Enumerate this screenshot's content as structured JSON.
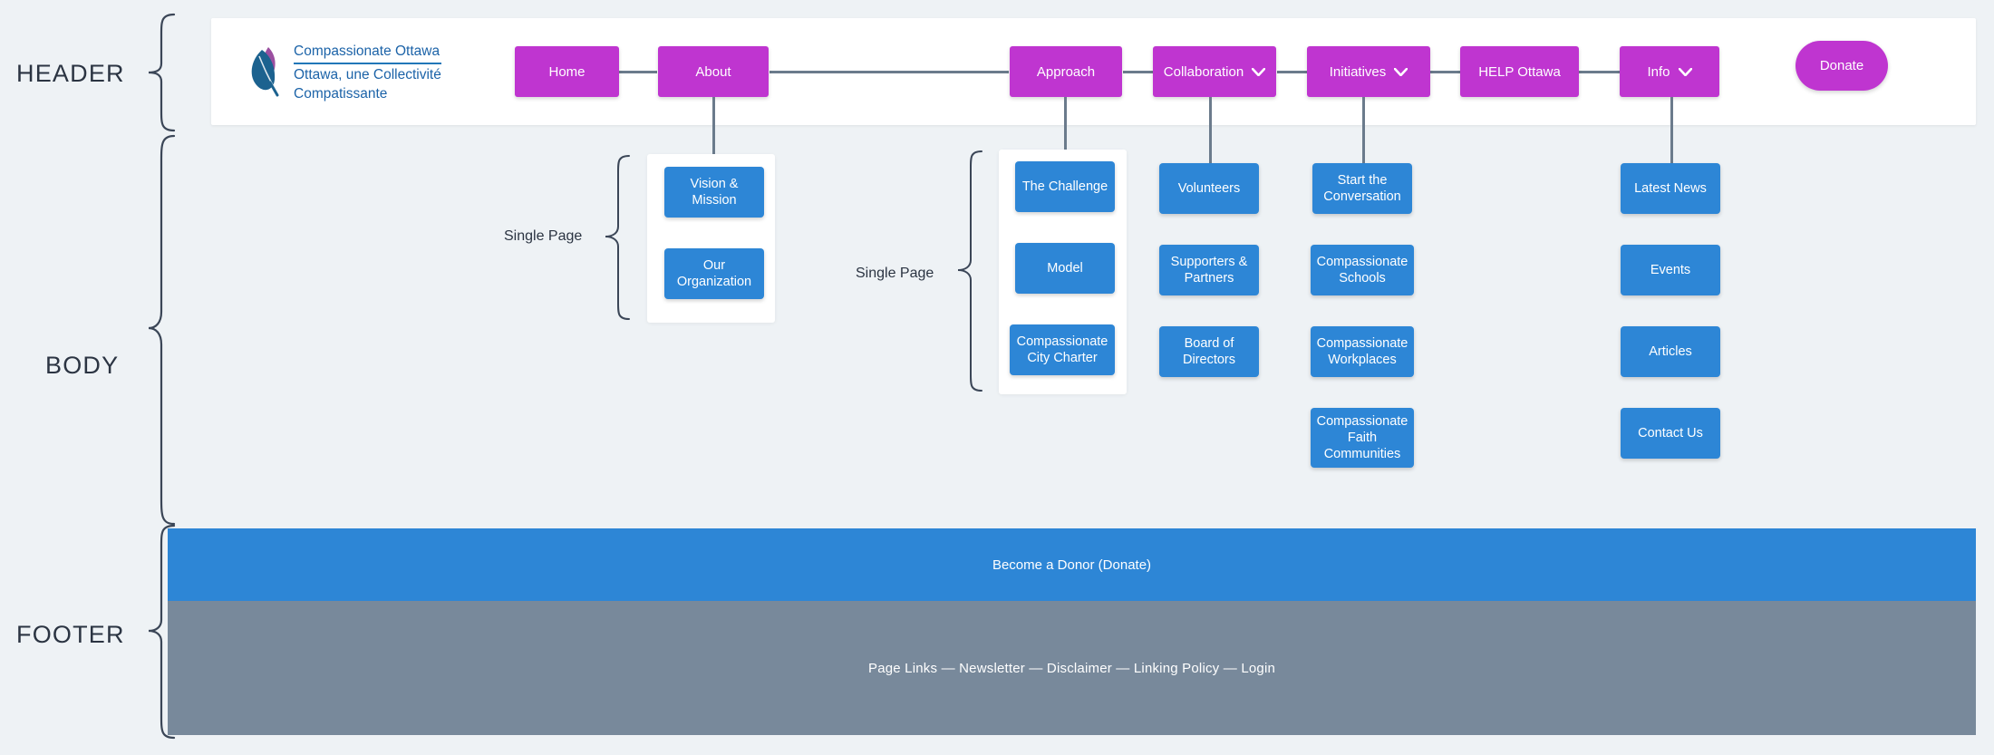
{
  "sections": {
    "header_label": "HEADER",
    "body_label": "BODY",
    "footer_label": "FOOTER"
  },
  "logo": {
    "icon": "leaf-logo-icon",
    "line1": "Compassionate Ottawa",
    "line2": "Ottawa, une Collectivité",
    "line3": "Compatissante"
  },
  "header": {
    "nav": [
      {
        "label": "Home",
        "has_dropdown": false
      },
      {
        "label": "About",
        "has_dropdown": false
      },
      {
        "label": "Approach",
        "has_dropdown": false
      },
      {
        "label": "Collaboration",
        "has_dropdown": true
      },
      {
        "label": "Initiatives",
        "has_dropdown": true
      },
      {
        "label": "HELP Ottawa",
        "has_dropdown": false
      },
      {
        "label": "Info",
        "has_dropdown": true
      }
    ],
    "donate_label": "Donate"
  },
  "body": {
    "single_page_label": "Single Page",
    "about_pages": [
      "Vision & Mission",
      "Our Organization"
    ],
    "approach_pages": [
      "The Challenge",
      "Model",
      "Compassionate City Charter"
    ],
    "collaboration_pages": [
      "Volunteers",
      "Supporters & Partners",
      "Board of Directors"
    ],
    "initiatives_pages": [
      "Start the Conversation",
      "Compassionate Schools",
      "Compassionate Workplaces",
      "Compassionate Faith Communities"
    ],
    "info_pages": [
      "Latest News",
      "Events",
      "Articles",
      "Contact Us"
    ]
  },
  "footer": {
    "donor_bar_label": "Become a Donor (Donate)",
    "links_label": "Page Links — Newsletter — Disclaimer — Linking Policy — Login"
  },
  "colors": {
    "background": "#eef2f5",
    "nav_magenta": "#bf35d0",
    "page_blue": "#2d86d6",
    "footer_gray": "#78899b",
    "connector_gray": "#6b7b8c",
    "logo_blue": "#1c63a8",
    "text_dark": "#2b3442"
  }
}
